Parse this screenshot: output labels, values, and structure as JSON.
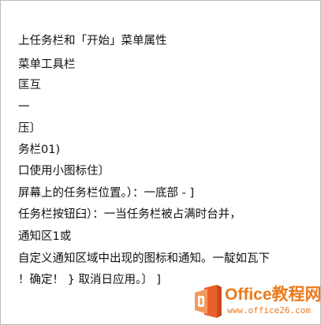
{
  "document": {
    "lines": [
      "上任务栏和「开始」菜单属性",
      "菜单工具栏",
      "匡互",
      "一",
      "压〕",
      "务栏01)",
      "口使用小图标住〕",
      "屏幕上的任务栏位置。）：一底部 - ]",
      "任务栏按钮臼）：一当任务栏被占满时台并，",
      "通知区1或",
      "自定义通知区域中出现的图标和通知。一靛如瓦下",
      "！确定！ } 取消日应用。〕 ]"
    ]
  },
  "watermark": {
    "title": "Office教程网",
    "url": "www.office26.com",
    "colors": {
      "text": "#ea7a1f",
      "logo_orange": "#e8612c",
      "logo_orange_light": "#f29a5b"
    }
  }
}
